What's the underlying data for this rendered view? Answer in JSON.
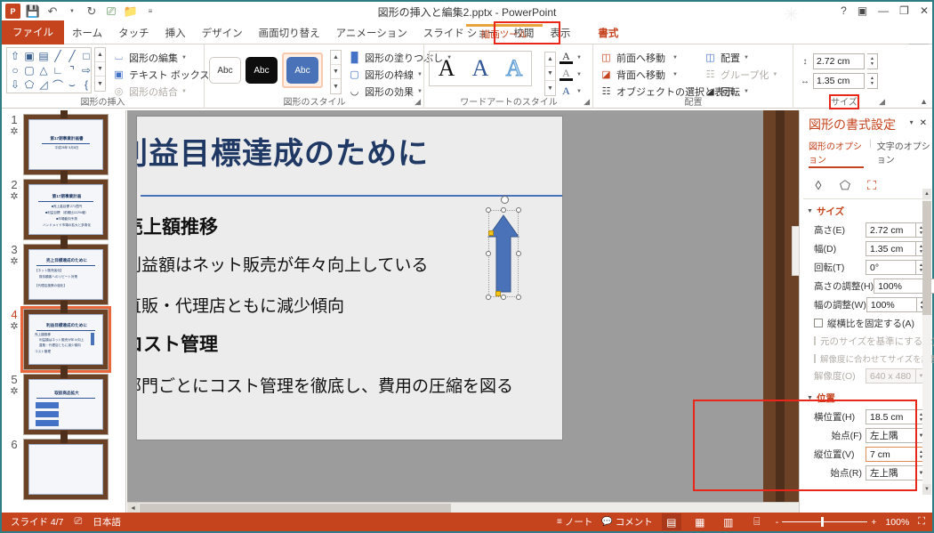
{
  "window": {
    "title": "図形の挿入と編集2.pptx - PowerPoint",
    "quick_access": [
      "save-icon",
      "undo-icon",
      "redo-icon",
      "present-icon",
      "open-icon",
      "more-icon"
    ],
    "controls": {
      "help": "?",
      "ribbon_options": "▣",
      "minimize": "—",
      "restore": "❐",
      "close": "✕"
    }
  },
  "tabs": {
    "context_label": "描画ツール",
    "items": [
      {
        "label": "ファイル",
        "kind": "file"
      },
      {
        "label": "ホーム",
        "kind": "normal"
      },
      {
        "label": "タッチ",
        "kind": "normal"
      },
      {
        "label": "挿入",
        "kind": "normal"
      },
      {
        "label": "デザイン",
        "kind": "normal"
      },
      {
        "label": "画面切り替え",
        "kind": "normal"
      },
      {
        "label": "アニメーション",
        "kind": "normal"
      },
      {
        "label": "スライド ショー",
        "kind": "normal"
      },
      {
        "label": "校閲",
        "kind": "normal"
      },
      {
        "label": "表示",
        "kind": "normal"
      },
      {
        "label": "書式",
        "kind": "context"
      }
    ]
  },
  "ribbon": {
    "groups": {
      "insert_shapes": {
        "title": "図形の挿入",
        "commands": [
          {
            "label": "図形の編集",
            "icon": "edit-shape-icon",
            "disabled": false
          },
          {
            "label": "テキスト ボックス",
            "icon": "textbox-icon",
            "disabled": false
          },
          {
            "label": "図形の結合",
            "icon": "merge-shapes-icon",
            "disabled": true
          }
        ]
      },
      "shape_styles": {
        "title": "図形のスタイル",
        "gallery": [
          "Abc",
          "Abc",
          "Abc"
        ],
        "commands": [
          {
            "label": "図形の塗りつぶし",
            "icon": "fill-icon"
          },
          {
            "label": "図形の枠線",
            "icon": "outline-icon"
          },
          {
            "label": "図形の効果",
            "icon": "effects-icon"
          }
        ]
      },
      "wordart_styles": {
        "title": "ワードアートのスタイル",
        "gallery": [
          "A",
          "A",
          "A"
        ],
        "commands": [
          {
            "icon": "text-fill-icon"
          },
          {
            "icon": "text-outline-icon"
          },
          {
            "icon": "text-effects-icon"
          }
        ]
      },
      "arrange": {
        "title": "配置",
        "commands": [
          {
            "label": "前面へ移動",
            "icon": "bring-forward-icon",
            "disabled": false
          },
          {
            "label": "背面へ移動",
            "icon": "send-backward-icon",
            "disabled": false
          },
          {
            "label": "オブジェクトの選択と表示",
            "icon": "selection-pane-icon",
            "disabled": false
          },
          {
            "label": "配置",
            "icon": "align-icon",
            "disabled": false
          },
          {
            "label": "グループ化",
            "icon": "group-icon",
            "disabled": true
          },
          {
            "label": "回転",
            "icon": "rotate-icon",
            "disabled": false
          }
        ]
      },
      "size": {
        "title": "サイズ",
        "height": "2.72 cm",
        "width": "1.35 cm",
        "dialog_launcher": "サイズ ダイアログ"
      }
    }
  },
  "thumbnails": [
    {
      "number": "1",
      "star": "✲",
      "selected": false,
      "title": "第17期事業計画書",
      "lines": [
        "平成26年 5月8日"
      ]
    },
    {
      "number": "2",
      "star": "✲",
      "selected": false,
      "title": "第17期事業計画",
      "lines": [
        "■売上高目標 271億円",
        "■利益目標 （前期比112%増）",
        "■市場動向予測",
        "ハンドメイド市場の拡大と多角化"
      ]
    },
    {
      "number": "3",
      "star": "✲",
      "selected": false,
      "title": "売上目標達成のために",
      "lines": [
        "【ネット販売強化】",
        "既存顧客へのリピート対策",
        "【代理店施策の強化】"
      ]
    },
    {
      "number": "4",
      "star": "✲",
      "selected": true,
      "title": "利益目標達成のために",
      "lines": [
        "売上額推移",
        "利益額はネット販売が年々向上",
        "直販・代理店ともに減少傾向",
        "コスト管理"
      ]
    },
    {
      "number": "5",
      "star": "✲",
      "selected": false,
      "title": "取扱商品拡大",
      "lines": [
        "既存商品",
        "新規商品",
        "コラボ商品"
      ]
    },
    {
      "number": "6",
      "star": "",
      "selected": false,
      "title": "",
      "lines": []
    }
  ],
  "slide": {
    "title": "利益目標達成のために",
    "body": [
      {
        "text": "売上額推移",
        "level": "heading"
      },
      {
        "text": "利益額はネット販売が年々向上している",
        "level": "text"
      },
      {
        "text": "直販・代理店ともに減少傾向",
        "level": "text"
      },
      {
        "text": "コスト管理",
        "level": "heading"
      },
      {
        "text": "部門ごとにコスト管理を徹底し、費用の圧縮を図る",
        "level": "text"
      }
    ],
    "selected_shape": "up-arrow-shape"
  },
  "format_pane": {
    "title": "図形の書式設定",
    "tabs": [
      {
        "label": "図形のオプション",
        "active": true
      },
      {
        "label": "文字のオプション",
        "active": false
      }
    ],
    "icon_tabs": [
      {
        "name": "fill-line-icon",
        "glyph": "◊",
        "active": false
      },
      {
        "name": "effects-icon",
        "glyph": "⬠",
        "active": false
      },
      {
        "name": "size-properties-icon",
        "glyph": "⛶",
        "active": true
      }
    ],
    "collapse": "▾",
    "close": "✕",
    "sections": [
      {
        "name": "size",
        "title": "サイズ",
        "highlighted": false,
        "rows": [
          {
            "type": "spin",
            "label": "高さ(E)",
            "value": "2.72 cm",
            "disabled": false,
            "highlight": false
          },
          {
            "type": "spin",
            "label": "幅(D)",
            "value": "1.35 cm",
            "disabled": false,
            "highlight": false
          },
          {
            "type": "spin",
            "label": "回転(T)",
            "value": "0°",
            "disabled": false,
            "highlight": false
          },
          {
            "type": "spin",
            "label": "高さの調整(H)",
            "value": "100%",
            "disabled": false,
            "highlight": false
          },
          {
            "type": "spin",
            "label": "幅の調整(W)",
            "value": "100%",
            "disabled": false,
            "highlight": false
          },
          {
            "type": "check",
            "label": "縦横比を固定する(A)",
            "checked": false,
            "disabled": false
          },
          {
            "type": "check",
            "label": "元のサイズを基準にする(R)",
            "checked": false,
            "disabled": true
          },
          {
            "type": "check",
            "label": "解像度に合わせてサイズを調整する(B)",
            "checked": false,
            "disabled": true
          },
          {
            "type": "dropdown",
            "label": "解像度(O)",
            "value": "640 x 480",
            "disabled": true,
            "highlight": false
          }
        ]
      },
      {
        "name": "position",
        "title": "位置",
        "highlighted": true,
        "rows": [
          {
            "type": "spin",
            "label": "横位置(H)",
            "value": "18.5 cm",
            "disabled": false,
            "highlight": false
          },
          {
            "type": "dropdown",
            "label": "始点(F)",
            "value": "左上隅",
            "disabled": false,
            "highlight": false
          },
          {
            "type": "spin",
            "label": "縦位置(V)",
            "value": "7 cm",
            "disabled": false,
            "highlight": true
          },
          {
            "type": "dropdown",
            "label": "始点(R)",
            "value": "左上隅",
            "disabled": false,
            "highlight": false
          }
        ]
      }
    ]
  },
  "status_bar": {
    "slide_indicator": "スライド 4/7",
    "language": "日本語",
    "accessibility_icon": "spellcheck-icon",
    "notes_label": "ノート",
    "comments_label": "コメント",
    "views": [
      {
        "name": "normal-view",
        "glyph": "▤",
        "active": true
      },
      {
        "name": "slide-sorter-view",
        "glyph": "▦",
        "active": false
      },
      {
        "name": "reading-view",
        "glyph": "▥",
        "active": false
      },
      {
        "name": "slideshow-view",
        "glyph": "⌸",
        "active": false
      }
    ],
    "zoom_out": "-",
    "zoom_in": "+",
    "zoom_level": "100%",
    "fit_window": "⛶"
  },
  "colors": {
    "accent": "#c5431d",
    "highlight_box": "#e8261a",
    "context_tab": "#e8a33d",
    "selection": "#e8673c",
    "shape_blue": "#4a72b8",
    "title_blue": "#1f3864"
  }
}
